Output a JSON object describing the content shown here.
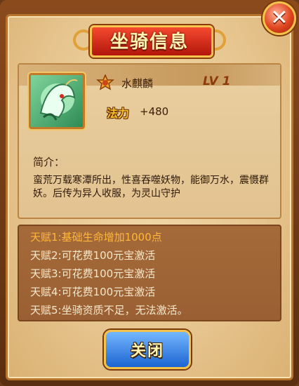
{
  "dialog": {
    "title": "坐骑信息",
    "close_icon_glyph": "✕"
  },
  "mount": {
    "name": "水麒麟",
    "level_label": "LV 1",
    "emblem_icon": "rank-emblem-icon",
    "stat_label": "法力",
    "stat_value": "+480",
    "intro_label": "简介：",
    "description": "蛮荒万载寒潭所出，性喜吞噬妖物，能御万水，震慑群妖。后传为异人收服，为灵山守护"
  },
  "talents": [
    {
      "text": "天赋1:基础生命增加1000点",
      "active": true
    },
    {
      "text": "天赋2:可花费100元宝激活",
      "active": false
    },
    {
      "text": "天赋3:可花费100元宝激活",
      "active": false
    },
    {
      "text": "天赋4:可花费100元宝激活",
      "active": false
    },
    {
      "text": "天赋5:坐骑资质不足，无法激活。",
      "active": false
    }
  ],
  "footer": {
    "close_label": "关闭"
  },
  "colors": {
    "active_talent": "#ffb63a",
    "inactive_talent": "#f5e8cc",
    "stat_label": "#f3c22a"
  }
}
